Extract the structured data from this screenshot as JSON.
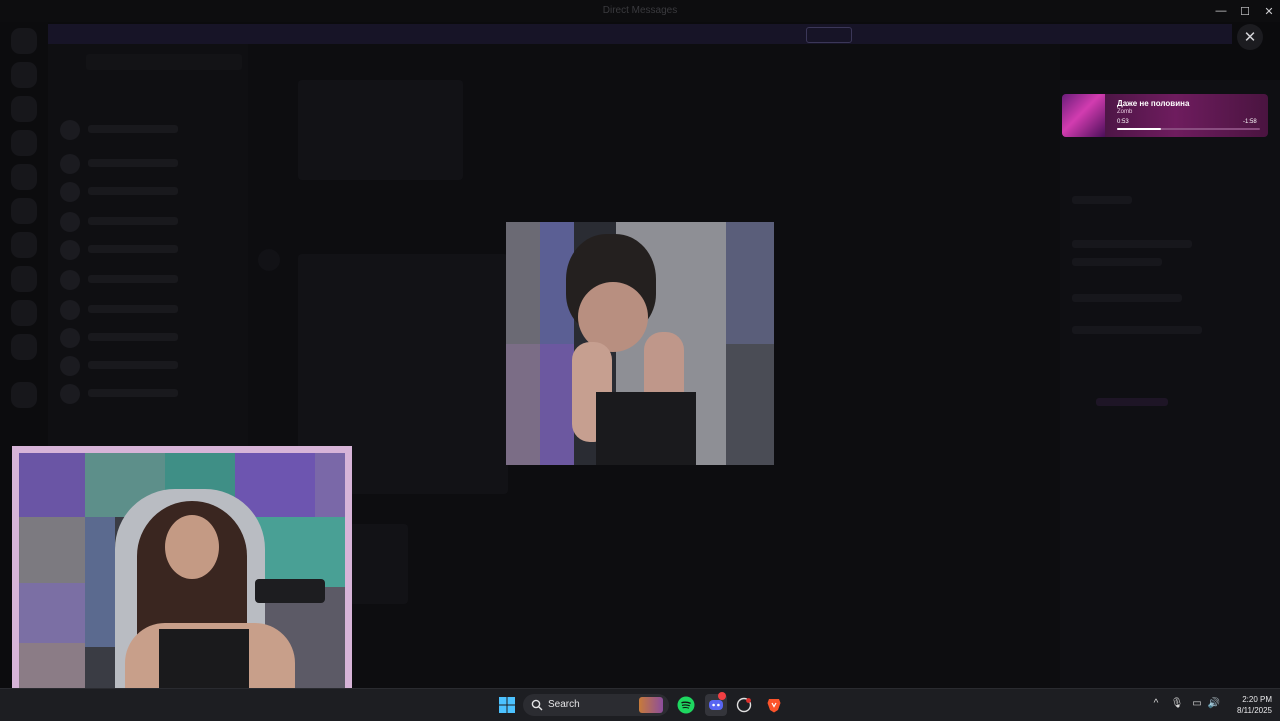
{
  "window": {
    "title": "Direct Messages",
    "minimize_glyph": "—",
    "maximize_glyph": "☐",
    "close_glyph": "✕"
  },
  "overlay": {
    "close_glyph": "✕"
  },
  "music_widget": {
    "song": "Даже не половина",
    "artist": "Zomb",
    "elapsed": "0:53",
    "remaining": "-1:58",
    "progress": 0.31,
    "accent": "#6e1c5e"
  },
  "taskbar": {
    "search_label": "Search",
    "time": "2:20 PM",
    "date": "8/11/2025",
    "icons": [
      "windows-start-icon",
      "search-icon",
      "spotify-icon",
      "discord-icon",
      "app-icon",
      "brave-icon"
    ],
    "tray_glyphs": [
      "^",
      "🎙",
      "▭",
      "🔊"
    ]
  }
}
